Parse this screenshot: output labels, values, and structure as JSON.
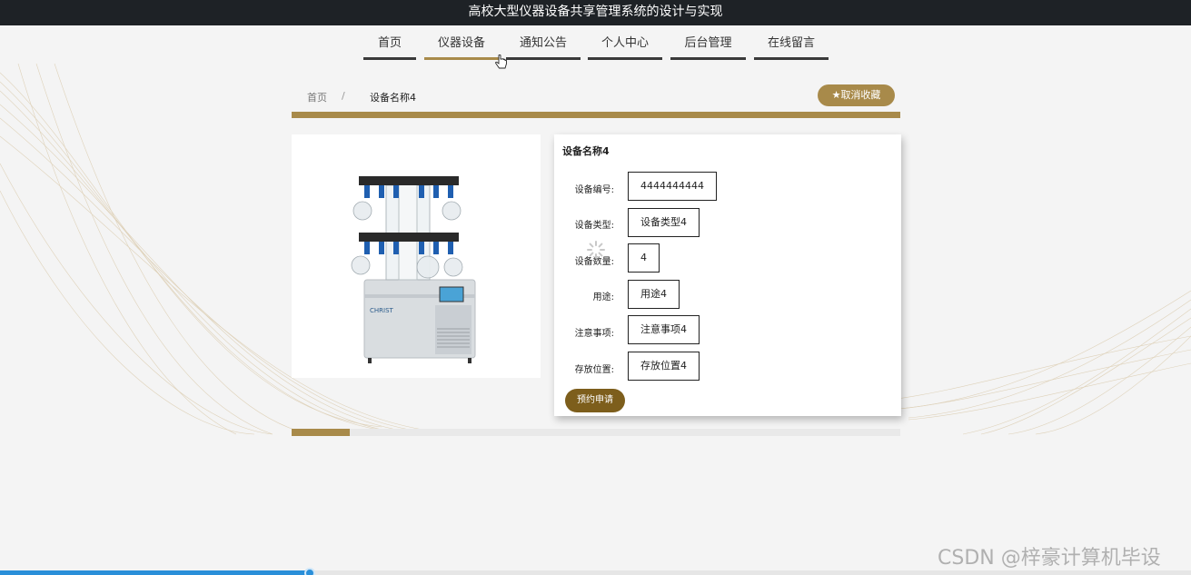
{
  "window": {
    "title": "高校大型仪器设备共享管理系统的设计与实现"
  },
  "nav": {
    "items": [
      {
        "label": "首页"
      },
      {
        "label": "仪器设备"
      },
      {
        "label": "通知公告"
      },
      {
        "label": "个人中心"
      },
      {
        "label": "后台管理"
      },
      {
        "label": "在线留言"
      }
    ],
    "active_index": 1
  },
  "breadcrumb": {
    "home": "首页",
    "separator": "/",
    "current": "设备名称4"
  },
  "favorite_button": {
    "icon": "star-icon",
    "label": "取消收藏"
  },
  "detail": {
    "title": "设备名称4",
    "fields": [
      {
        "label": "设备编号:",
        "value": "4444444444"
      },
      {
        "label": "设备类型:",
        "value": "设备类型4"
      },
      {
        "label": "设备数量:",
        "value": "4"
      },
      {
        "label": "用途:",
        "value": "用途4"
      },
      {
        "label": "注意事项:",
        "value": "注意事项4"
      },
      {
        "label": "存放位置:",
        "value": "存放位置4"
      }
    ],
    "apply_label": "预约申请"
  },
  "product_image": {
    "brand_text": "CHRIST"
  },
  "watermark": "CSDN @梓豪计算机毕设",
  "colors": {
    "accent": "#a88a4a",
    "apply_button": "#7d5e1c",
    "topbar": "#1e2226",
    "scrollbar": "#2a8fd9"
  }
}
